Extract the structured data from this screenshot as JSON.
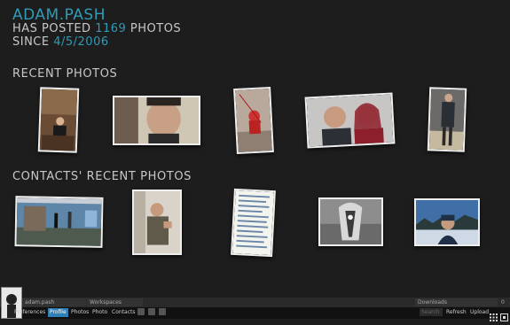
{
  "header": {
    "username": "ADAM.PASH",
    "line1_pre": "HAS POSTED ",
    "photo_count": "1169",
    "line1_post": " PHOTOS",
    "line2_pre": "SINCE ",
    "since_date": "4/5/2006"
  },
  "sections": {
    "recent": "RECENT PHOTOS",
    "contacts": "CONTACTS' RECENT PHOTOS"
  },
  "dock": {
    "user": "adam.pash",
    "workspaces": "Workspaces",
    "downloads": "Downloads",
    "downloads_count": "0",
    "tabs": [
      "Preferences",
      "Profile",
      "Photos",
      "Photo",
      "Contacts"
    ],
    "active_tab": "Profile",
    "search_placeholder": "Search",
    "refresh": "Refresh",
    "upload": "Upload"
  },
  "icons": {
    "face": "face-icon",
    "grid": "grid-view-icon",
    "fullscreen": "fullscreen-icon"
  },
  "colors": {
    "accent": "#2f9bb7",
    "active_tab": "#2f7fb8",
    "background": "#1d1d1d"
  }
}
